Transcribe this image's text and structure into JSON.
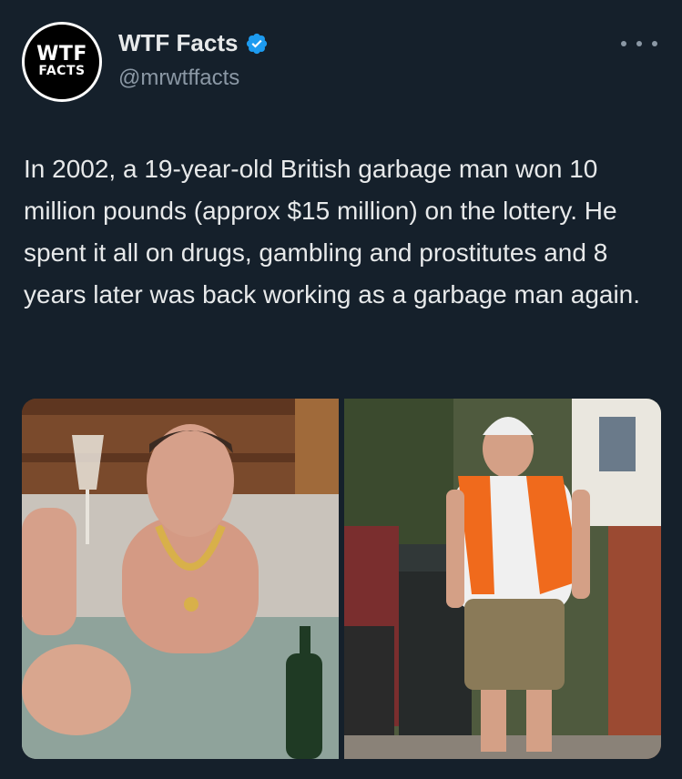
{
  "account": {
    "avatar_line1": "WTF",
    "avatar_line2": "FACTS",
    "name": "WTF Facts",
    "handle": "@mrwtffacts",
    "verified": true
  },
  "tweet": {
    "text": "In 2002, a 19-year-old British garbage man won 10 million pounds (approx $15 million) on the lottery. He spent it all on drugs, gambling and prostitutes and 8 years later was back working as a garbage man again."
  },
  "icons": {
    "verified": "verified-badge-icon",
    "more": "more-options-icon"
  },
  "colors": {
    "background": "#15202b",
    "text": "#e7e9ea",
    "secondary": "#8b98a5",
    "verified": "#1d9bf0"
  }
}
